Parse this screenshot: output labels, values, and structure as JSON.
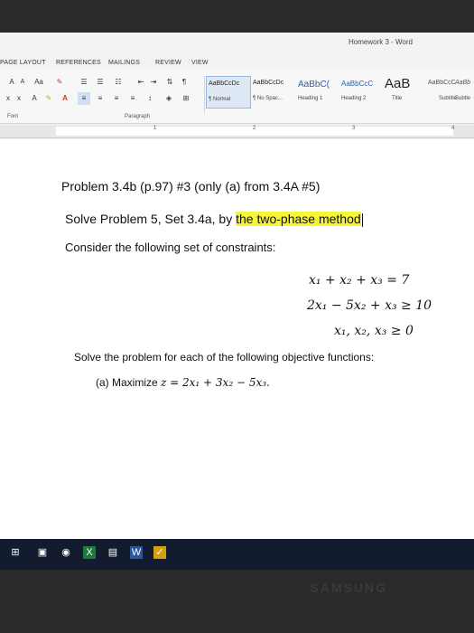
{
  "window": {
    "title": "Homework 3 - Word"
  },
  "ribbon_tabs": [
    "PAGE LAYOUT",
    "REFERENCES",
    "MAILINGS",
    "REVIEW",
    "VIEW"
  ],
  "ribbon": {
    "font_row1": [
      "A",
      "A",
      "Aa"
    ],
    "font_row2": [
      "x",
      "x",
      "A",
      "A"
    ],
    "group_font": "Font",
    "group_paragraph": "Paragraph"
  },
  "styles": [
    {
      "sample": "AaBbCcDc",
      "name": "¶ Normal",
      "selected": true
    },
    {
      "sample": "AaBbCcDc",
      "name": "¶ No Spac..."
    },
    {
      "sample": "AaBbC(",
      "name": "Heading 1"
    },
    {
      "sample": "AaBbCcC",
      "name": "Heading 2"
    },
    {
      "sample": "AaB",
      "name": "Title"
    },
    {
      "sample": "AaBbCcC",
      "name": "Subtitle"
    },
    {
      "sample": "AaBb",
      "name": "Subtle"
    }
  ],
  "ruler": {
    "numbers": [
      "1",
      "2",
      "3",
      "4"
    ]
  },
  "document": {
    "problem_title": "Problem 3.4b (p.97) #3 (only (a) from 3.4A #5)",
    "solve_prefix": "Solve Problem 5, Set 3.4a, by ",
    "solve_highlight": "the two-phase method",
    "consider": "Consider the following set of constraints:",
    "constraint1": "x₁ + x₂ + x₃ = 7",
    "constraint2": "2x₁ − 5x₂ + x₃ ≥ 10",
    "constraint3": "x₁, x₂, x₃ ≥ 0",
    "objective_intro": "Solve the problem for each of the following objective functions:",
    "part_a_label": "(a) Maximize ",
    "part_a_math": "z = 2x₁ + 3x₂ − 5x₃."
  },
  "bezel": {
    "brand": "SAMSUNG"
  },
  "colors": {
    "highlight": "#f5f53a",
    "taskbar": "#121c2e",
    "ribbon": "#f7f7f7"
  }
}
